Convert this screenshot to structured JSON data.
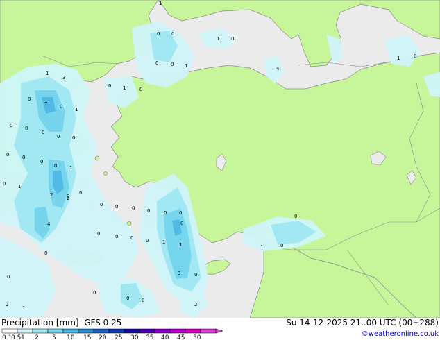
{
  "header": {
    "left_title": "Precipitation [mm]",
    "model": "GFS 0.25",
    "valid_time": "Su 14-12-2025 21..00 UTC (00+288)",
    "credit": "©weatheronline.co.uk"
  },
  "legend": {
    "labels": [
      "0.1",
      "0.5",
      "1",
      "2",
      "5",
      "10",
      "15",
      "20",
      "25",
      "30",
      "35",
      "40",
      "45",
      "50"
    ],
    "colors": [
      "#ffffff",
      "#cff5f8",
      "#9fe7f2",
      "#74d5ec",
      "#4ab5e3",
      "#2d8ed4",
      "#1d62c4",
      "#1338ae",
      "#160c96",
      "#4d00b0",
      "#8a00c8",
      "#b800d0",
      "#d800c0",
      "#e040d8"
    ]
  },
  "map_values": [
    "1",
    "0",
    "0",
    "1",
    "0",
    "1",
    "0",
    "4",
    "1",
    "0",
    "0",
    "0",
    "0",
    "1",
    "1",
    "3",
    "7",
    "0",
    "1",
    "0",
    "0",
    "0",
    "0",
    "0",
    "0",
    "1",
    "0",
    "0",
    "0",
    "0",
    "0",
    "1",
    "0",
    "0",
    "2",
    "2",
    "0",
    "0",
    "0",
    "0",
    "0",
    "0",
    "0",
    "0",
    "0",
    "4",
    "0",
    "1",
    "1",
    "0",
    "0",
    "0",
    "3",
    "0",
    "1",
    "0",
    "0",
    "0",
    "2",
    "0",
    "2",
    "1",
    "0"
  ],
  "colors": {
    "land": "#c6f59a",
    "sea": "#ebebeb",
    "border": "#8a8a8a",
    "bar_border": "#000000"
  }
}
